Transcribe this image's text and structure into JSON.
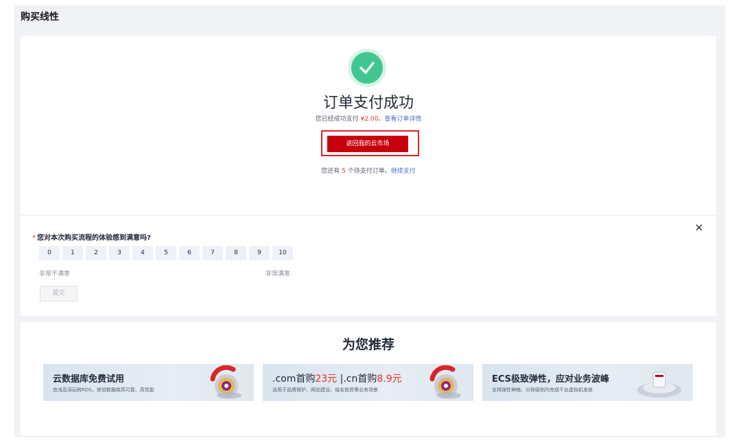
{
  "page": {
    "title": "购买线性"
  },
  "success": {
    "title": "订单支付成功",
    "paid_prefix": "您已经成功支付 ",
    "amount": "¥2.00",
    "paid_sep": "。",
    "detail_link": "查看订单详情",
    "return_button": "返回我的云市场",
    "pending_prefix": "您还有 ",
    "pending_count": "5",
    "pending_suffix": " 个待支付订单。",
    "continue_link": "继续支付"
  },
  "survey": {
    "required_mark": "*",
    "question": "您对本次购买流程的体验感到满意吗?",
    "scores": [
      "0",
      "1",
      "2",
      "3",
      "4",
      "5",
      "6",
      "7",
      "8",
      "9",
      "10"
    ],
    "low_label": "非常不满意",
    "high_label": "非常满意",
    "submit": "提交"
  },
  "recommend": {
    "title": "为您推荐",
    "banners": [
      {
        "title": "云数据库免费试用",
        "subtitle": "由浅及深玩转RDS，体验数据库高可靠、高性能"
      },
      {
        "title_a": ".com首购",
        "title_b": "23元",
        "title_c": " |.cn首购",
        "title_d": "8.9元",
        "subtitle": "适用于品牌保护、网站建设、域名投资等业务场景"
      },
      {
        "title": "ECS极致弹性，应对业务波峰",
        "subtitle": "支持弹性伸缩，分钟级别内完成千台虚拟机发放"
      }
    ]
  },
  "colors": {
    "accent": "#c7000b",
    "success": "#40c790",
    "link": "#526ecc",
    "price": "#e1302e"
  }
}
